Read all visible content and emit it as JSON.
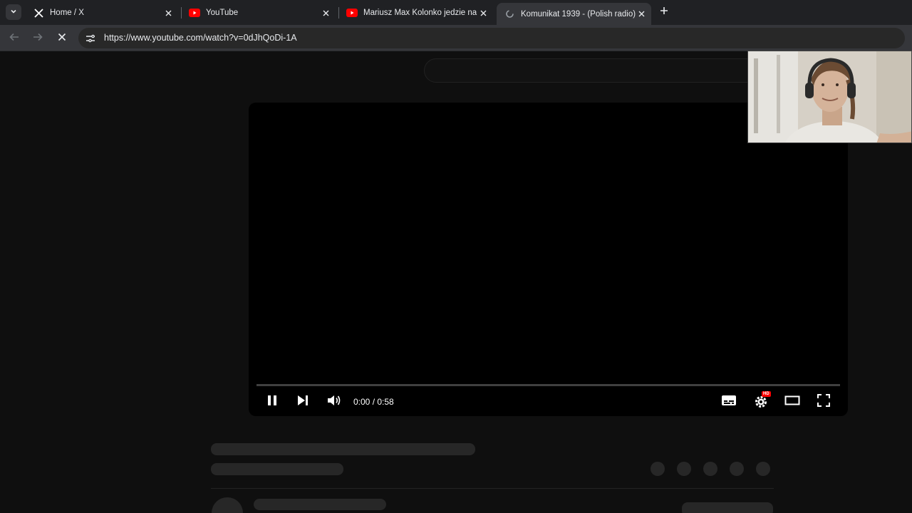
{
  "browser": {
    "tabs": [
      {
        "title": "Home / X",
        "favicon": "x-logo-icon",
        "active": false
      },
      {
        "title": "YouTube",
        "favicon": "youtube-logo-icon",
        "active": false
      },
      {
        "title": "Mariusz Max Kolonko jedzie na",
        "favicon": "youtube-logo-icon",
        "active": false
      },
      {
        "title": "Komunikat 1939 - (Polish radio)",
        "favicon": "loading-icon",
        "active": true
      }
    ],
    "url": "https://www.youtube.com/watch?v=0dJhQoDi-1A"
  },
  "player": {
    "time": "0:00 / 0:58",
    "settings_badge": "HD",
    "progress": 0.0
  },
  "colors": {
    "youtube_red": "#ff0000",
    "page_bg": "#0f0f0f",
    "skeleton": "#272727"
  }
}
